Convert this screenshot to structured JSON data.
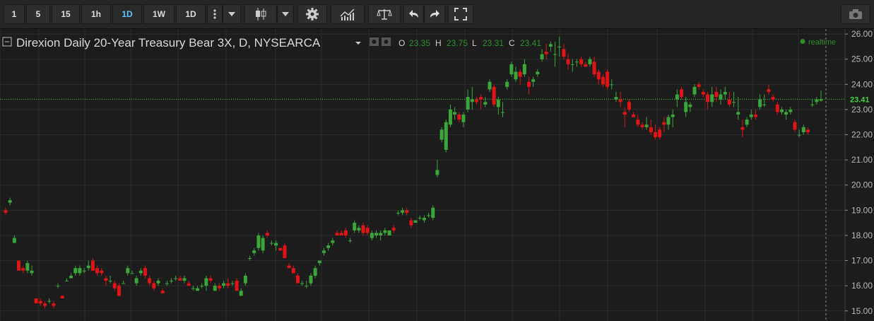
{
  "toolbar": {
    "intervals": [
      "1",
      "5",
      "15",
      "1h",
      "1D",
      "1W",
      "1D"
    ],
    "active_interval": "1D",
    "icons": [
      "more-vert-icon",
      "chevron-down-icon",
      "candlestick-icon",
      "chevron-down-icon",
      "gear-icon",
      "indicators-icon",
      "scale-icon",
      "undo-icon",
      "redo-icon",
      "fullscreen-icon",
      "camera-icon"
    ]
  },
  "legend": {
    "title": "Direxion Daily 20-Year Treasury Bear 3X, D, NYSEARCA",
    "o_label": "O",
    "o_value": "23.35",
    "h_label": "H",
    "h_value": "23.75",
    "l_label": "L",
    "l_value": "23.31",
    "c_label": "C",
    "c_value": "23.41",
    "realtime": "realtime"
  },
  "colors": {
    "up": "#3aa63a",
    "down": "#e01414",
    "background": "#1c1c1c",
    "grid": "#2b2b2b",
    "last_price": "#44d244"
  },
  "chart_data": {
    "type": "candlestick",
    "last_price": "23.41",
    "ylim": [
      14.6,
      26.2
    ],
    "yticks": [
      "15.00",
      "16.00",
      "17.00",
      "18.00",
      "19.00",
      "20.00",
      "21.00",
      "22.00",
      "23.00",
      "24.00",
      "25.00",
      "26.00"
    ],
    "grid": true,
    "candles": [
      [
        19.0,
        19.1,
        18.8,
        18.9
      ],
      [
        19.3,
        19.5,
        19.2,
        19.4
      ],
      [
        17.7,
        18.0,
        17.7,
        17.9
      ],
      [
        17.0,
        17.0,
        16.6,
        16.6
      ],
      [
        16.7,
        16.8,
        16.5,
        16.6
      ],
      [
        16.6,
        17.0,
        16.5,
        16.9
      ],
      [
        16.5,
        16.8,
        16.4,
        16.6
      ],
      [
        15.5,
        15.5,
        15.3,
        15.3
      ],
      [
        15.4,
        15.5,
        15.2,
        15.3
      ],
      [
        15.3,
        15.4,
        15.1,
        15.2
      ],
      [
        15.4,
        15.5,
        15.3,
        15.4
      ],
      [
        15.3,
        15.4,
        15.1,
        15.2
      ],
      [
        16.0,
        16.1,
        15.9,
        16.0
      ],
      [
        15.6,
        15.6,
        15.5,
        15.5
      ],
      [
        16.2,
        16.3,
        16.2,
        16.2
      ],
      [
        16.3,
        16.5,
        16.3,
        16.4
      ],
      [
        16.5,
        16.8,
        16.4,
        16.7
      ],
      [
        16.5,
        16.8,
        16.4,
        16.7
      ],
      [
        16.6,
        16.7,
        16.5,
        16.6
      ],
      [
        16.7,
        17.0,
        16.6,
        16.8
      ],
      [
        17.0,
        17.1,
        16.6,
        16.6
      ],
      [
        16.7,
        16.8,
        16.4,
        16.5
      ],
      [
        16.6,
        16.7,
        16.4,
        16.5
      ],
      [
        16.3,
        16.4,
        16.0,
        16.2
      ],
      [
        16.2,
        16.4,
        16.1,
        16.2
      ],
      [
        16.1,
        16.2,
        15.8,
        15.9
      ],
      [
        16.0,
        16.1,
        15.6,
        15.6
      ],
      [
        16.1,
        16.2,
        16.1,
        16.1
      ],
      [
        16.5,
        16.8,
        16.4,
        16.7
      ],
      [
        16.5,
        16.6,
        16.5,
        16.5
      ],
      [
        16.1,
        16.4,
        16.0,
        16.3
      ],
      [
        16.5,
        16.7,
        16.4,
        16.6
      ],
      [
        16.7,
        16.8,
        16.3,
        16.4
      ],
      [
        16.3,
        16.4,
        16.0,
        16.1
      ],
      [
        16.1,
        16.2,
        15.8,
        15.9
      ],
      [
        16.1,
        16.3,
        16.0,
        16.2
      ],
      [
        15.8,
        15.9,
        15.7,
        15.7
      ],
      [
        16.1,
        16.2,
        16.0,
        16.1
      ],
      [
        16.2,
        16.3,
        16.1,
        16.2
      ],
      [
        16.3,
        16.4,
        16.2,
        16.3
      ],
      [
        16.3,
        16.4,
        16.2,
        16.2
      ],
      [
        16.2,
        16.4,
        16.1,
        16.3
      ],
      [
        16.1,
        16.2,
        16.0,
        16.0
      ],
      [
        15.9,
        16.0,
        15.8,
        15.9
      ],
      [
        15.8,
        16.0,
        15.8,
        15.9
      ],
      [
        16.0,
        16.1,
        15.9,
        16.0
      ],
      [
        16.0,
        16.4,
        15.8,
        16.3
      ],
      [
        16.3,
        16.4,
        16.1,
        16.2
      ],
      [
        15.8,
        16.1,
        15.8,
        16.0
      ],
      [
        16.0,
        16.1,
        15.8,
        15.9
      ],
      [
        16.0,
        16.2,
        15.9,
        16.1
      ],
      [
        16.1,
        16.3,
        15.9,
        16.0
      ],
      [
        16.1,
        16.2,
        16.0,
        16.1
      ],
      [
        16.2,
        16.3,
        15.8,
        15.8
      ],
      [
        15.6,
        15.9,
        15.6,
        15.8
      ],
      [
        16.1,
        16.5,
        16.0,
        16.4
      ],
      [
        17.1,
        17.2,
        17.0,
        17.1
      ],
      [
        17.3,
        17.5,
        17.2,
        17.4
      ],
      [
        17.5,
        18.1,
        17.4,
        18.0
      ],
      [
        17.4,
        18.0,
        17.3,
        17.9
      ],
      [
        18.1,
        18.2,
        17.9,
        18.0
      ],
      [
        17.7,
        17.8,
        17.6,
        17.7
      ],
      [
        17.6,
        17.8,
        17.4,
        17.7
      ],
      [
        17.5,
        17.5,
        17.4,
        17.4
      ],
      [
        17.6,
        17.7,
        17.1,
        17.1
      ],
      [
        16.8,
        16.9,
        16.7,
        16.7
      ],
      [
        16.7,
        16.8,
        16.5,
        16.5
      ],
      [
        16.4,
        16.5,
        16.1,
        16.1
      ],
      [
        16.1,
        16.2,
        16.0,
        16.1
      ],
      [
        16.0,
        16.2,
        15.9,
        16.0
      ],
      [
        16.1,
        16.5,
        16.0,
        16.4
      ],
      [
        16.4,
        16.8,
        16.3,
        16.7
      ],
      [
        16.9,
        17.0,
        16.8,
        17.0
      ],
      [
        17.3,
        17.5,
        17.2,
        17.4
      ],
      [
        17.5,
        17.7,
        17.4,
        17.6
      ],
      [
        17.7,
        17.9,
        17.6,
        17.8
      ],
      [
        18.1,
        18.2,
        18.0,
        18.0
      ],
      [
        18.1,
        18.2,
        18.0,
        18.0
      ],
      [
        18.2,
        18.3,
        17.9,
        18.0
      ],
      [
        17.8,
        17.9,
        17.7,
        17.8
      ],
      [
        18.2,
        18.6,
        18.1,
        18.5
      ],
      [
        18.2,
        18.4,
        18.1,
        18.3
      ],
      [
        18.4,
        18.5,
        18.0,
        18.1
      ],
      [
        18.3,
        18.4,
        18.0,
        18.1
      ],
      [
        17.9,
        18.2,
        17.8,
        18.1
      ],
      [
        18.0,
        18.2,
        17.9,
        18.1
      ],
      [
        18.0,
        18.2,
        17.8,
        18.1
      ],
      [
        18.1,
        18.3,
        18.0,
        18.2
      ],
      [
        18.0,
        18.2,
        18.0,
        18.2
      ],
      [
        18.3,
        18.4,
        18.1,
        18.2
      ],
      [
        18.9,
        19.0,
        18.8,
        18.9
      ],
      [
        18.9,
        19.1,
        18.8,
        19.0
      ],
      [
        19.0,
        19.1,
        18.8,
        18.9
      ],
      [
        18.6,
        18.7,
        18.3,
        18.4
      ],
      [
        18.5,
        18.6,
        18.5,
        18.6
      ],
      [
        18.7,
        18.8,
        18.6,
        18.7
      ],
      [
        18.6,
        18.8,
        18.5,
        18.7
      ],
      [
        18.8,
        18.9,
        18.7,
        18.8
      ],
      [
        18.7,
        19.2,
        18.6,
        19.1
      ],
      [
        20.4,
        21.0,
        20.3,
        20.6
      ],
      [
        21.8,
        22.3,
        21.7,
        22.2
      ],
      [
        21.4,
        22.6,
        21.3,
        22.5
      ],
      [
        22.4,
        23.2,
        22.3,
        23.0
      ],
      [
        22.8,
        23.1,
        22.6,
        22.9
      ],
      [
        22.8,
        22.9,
        22.5,
        22.6
      ],
      [
        22.5,
        22.9,
        22.3,
        22.8
      ],
      [
        23.0,
        23.8,
        22.9,
        23.5
      ],
      [
        23.3,
        23.9,
        23.0,
        23.4
      ],
      [
        23.4,
        23.5,
        23.2,
        23.3
      ],
      [
        23.5,
        23.6,
        23.0,
        23.4
      ],
      [
        23.2,
        23.5,
        23.1,
        23.3
      ],
      [
        23.8,
        24.2,
        23.7,
        24.1
      ],
      [
        23.9,
        24.0,
        23.1,
        23.2
      ],
      [
        23.1,
        23.5,
        22.8,
        23.4
      ],
      [
        22.9,
        23.3,
        22.7,
        22.9
      ],
      [
        23.9,
        24.2,
        23.8,
        24.1
      ],
      [
        24.4,
        24.9,
        24.3,
        24.8
      ],
      [
        24.2,
        24.7,
        24.1,
        24.5
      ],
      [
        24.5,
        24.6,
        24.0,
        24.3
      ],
      [
        24.4,
        25.0,
        24.3,
        24.8
      ],
      [
        24.1,
        24.3,
        23.6,
        23.9
      ],
      [
        24.1,
        24.3,
        23.9,
        24.2
      ],
      [
        24.4,
        24.6,
        24.3,
        24.5
      ],
      [
        25.0,
        25.4,
        24.9,
        25.2
      ],
      [
        25.3,
        25.6,
        25.0,
        25.2
      ],
      [
        25.5,
        25.7,
        25.3,
        25.6
      ],
      [
        25.2,
        25.7,
        24.7,
        25.2
      ],
      [
        25.5,
        25.9,
        25.1,
        25.5
      ],
      [
        25.4,
        25.6,
        25.0,
        25.1
      ],
      [
        25.0,
        25.2,
        24.6,
        24.8
      ],
      [
        24.8,
        25.0,
        24.5,
        24.8
      ],
      [
        24.9,
        25.0,
        24.7,
        24.9
      ],
      [
        25.0,
        25.1,
        24.7,
        24.8
      ],
      [
        24.8,
        24.9,
        24.7,
        24.7
      ],
      [
        24.8,
        25.1,
        24.7,
        25.0
      ],
      [
        24.9,
        25.1,
        24.3,
        24.4
      ],
      [
        24.5,
        24.6,
        24.0,
        24.2
      ],
      [
        24.3,
        24.4,
        23.9,
        24.0
      ],
      [
        24.5,
        24.6,
        23.8,
        23.9
      ],
      [
        24.0,
        24.2,
        23.8,
        24.0
      ],
      [
        23.4,
        23.7,
        23.3,
        23.5
      ],
      [
        23.4,
        23.7,
        23.1,
        23.3
      ],
      [
        22.9,
        23.1,
        22.3,
        22.8
      ],
      [
        23.3,
        23.4,
        22.9,
        23.0
      ],
      [
        22.8,
        22.9,
        22.7,
        22.7
      ],
      [
        22.6,
        22.8,
        22.3,
        22.4
      ],
      [
        22.4,
        22.5,
        22.2,
        22.3
      ],
      [
        22.3,
        22.7,
        22.2,
        22.4
      ],
      [
        22.3,
        22.6,
        22.0,
        22.1
      ],
      [
        22.1,
        22.4,
        21.8,
        21.9
      ],
      [
        22.2,
        22.3,
        21.8,
        21.9
      ],
      [
        22.5,
        22.7,
        22.1,
        22.4
      ],
      [
        22.4,
        22.8,
        22.2,
        22.7
      ],
      [
        22.7,
        23.0,
        22.3,
        22.8
      ],
      [
        23.4,
        23.8,
        23.1,
        23.6
      ],
      [
        23.8,
        23.9,
        23.4,
        23.5
      ],
      [
        22.9,
        23.5,
        22.7,
        23.3
      ],
      [
        23.1,
        23.3,
        22.9,
        23.2
      ],
      [
        23.6,
        24.0,
        23.5,
        23.9
      ],
      [
        24.0,
        24.1,
        23.8,
        23.9
      ],
      [
        23.7,
        23.8,
        23.5,
        23.6
      ],
      [
        23.6,
        23.7,
        23.0,
        23.3
      ],
      [
        23.3,
        23.9,
        23.1,
        23.6
      ],
      [
        23.7,
        23.9,
        23.3,
        23.5
      ],
      [
        23.4,
        23.8,
        23.2,
        23.6
      ],
      [
        23.6,
        23.9,
        23.4,
        23.7
      ],
      [
        23.4,
        23.7,
        23.1,
        23.2
      ],
      [
        23.3,
        23.7,
        23.1,
        23.3
      ],
      [
        22.8,
        23.5,
        22.6,
        22.9
      ],
      [
        22.3,
        22.6,
        21.9,
        22.2
      ],
      [
        22.4,
        22.7,
        22.3,
        22.6
      ],
      [
        22.7,
        23.0,
        22.6,
        22.8
      ],
      [
        22.8,
        23.0,
        22.6,
        22.7
      ],
      [
        23.1,
        23.6,
        23.0,
        23.4
      ],
      [
        23.2,
        23.6,
        23.1,
        23.2
      ],
      [
        23.8,
        24.0,
        23.6,
        23.7
      ],
      [
        23.5,
        23.6,
        23.3,
        23.4
      ],
      [
        23.2,
        23.3,
        22.8,
        22.9
      ],
      [
        22.9,
        23.1,
        22.8,
        23.0
      ],
      [
        22.8,
        23.0,
        22.6,
        22.9
      ],
      [
        22.9,
        23.1,
        22.8,
        23.0
      ],
      [
        22.5,
        22.6,
        22.1,
        22.2
      ],
      [
        22.0,
        22.2,
        21.9,
        22.0
      ],
      [
        22.1,
        22.4,
        22.0,
        22.3
      ],
      [
        22.2,
        22.3,
        22.0,
        22.1
      ],
      [
        23.2,
        23.4,
        23.1,
        23.2
      ],
      [
        23.3,
        23.5,
        23.2,
        23.4
      ],
      [
        23.35,
        23.75,
        23.31,
        23.41
      ]
    ]
  }
}
